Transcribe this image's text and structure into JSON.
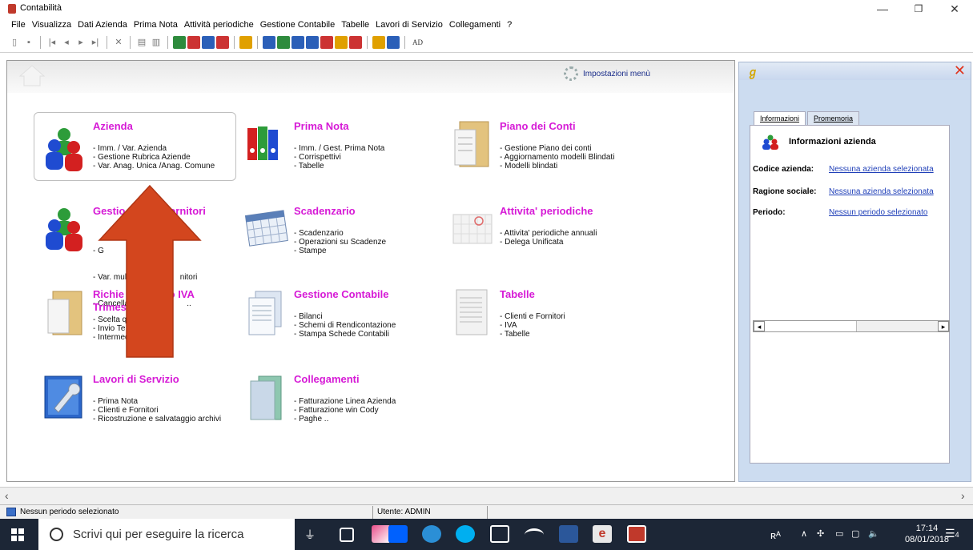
{
  "window": {
    "title": "Contabilità",
    "controls": {
      "minimize": "—",
      "maximize": "❐",
      "close": "✕"
    }
  },
  "menu": [
    "File",
    "Visualizza",
    "Dati Azienda",
    "Prima Nota",
    "Attività periodiche",
    "Gestione Contabile",
    "Tabelle",
    "Lavori di Servizio",
    "Collegamenti",
    "?"
  ],
  "toolbar": {
    "ad_label": "AD"
  },
  "main": {
    "settings_label": "Impostazioni menù",
    "cards": [
      {
        "id": "azienda",
        "title": "Azienda",
        "lines": [
          "- Imm. / Var.  Azienda",
          "- Gestione Rubrica Aziende",
          "- Var. Anag. Unica /Anag. Comune"
        ]
      },
      {
        "id": "prima-nota",
        "title": "Prima Nota",
        "lines": [
          "- Imm. / Gest. Prima Nota",
          "- Corrispettivi",
          "- Tabelle"
        ]
      },
      {
        "id": "piano-conti",
        "title": "Piano dei Conti",
        "lines": [
          "- Gestione Piano dei conti",
          "- Aggiornamento modelli Blindati",
          "- Modelli blindati"
        ]
      },
      {
        "id": "clienti-fornitori",
        "title": "Gestio          e Fornitori",
        "lines": [
          "- G",
          "- Var. mul                        nitori",
          "- Cancella                          .."
        ]
      },
      {
        "id": "scadenzario",
        "title": "Scadenzario",
        "lines": [
          "- Scadenzario",
          "- Operazioni su Scadenze",
          "- Stampe"
        ]
      },
      {
        "id": "attivita-periodiche",
        "title": "Attivita' periodiche",
        "lines": [
          "- Attivita' periodiche annuali",
          "- Delega Unificata"
        ]
      },
      {
        "id": "rimborso-iva",
        "title": "Richie            rso IVA",
        "title2": "Trimes",
        "lines": [
          "- Scelta q",
          "- Invio Te",
          "- Intermediari"
        ]
      },
      {
        "id": "gestione-contabile",
        "title": "Gestione Contabile",
        "lines": [
          "- Bilanci",
          "- Schemi di Rendicontazione",
          "- Stampa Schede Contabili"
        ]
      },
      {
        "id": "tabelle",
        "title": "Tabelle",
        "lines": [
          "- Clienti e Fornitori",
          "- IVA",
          "- Tabelle"
        ]
      },
      {
        "id": "lavori-servizio",
        "title": "Lavori di Servizio",
        "lines": [
          "- Prima Nota",
          "- Clienti e Fornitori",
          "- Ricostruzione e salvataggio archivi"
        ]
      },
      {
        "id": "collegamenti",
        "title": "Collegamenti",
        "lines": [
          "- Fatturazione Linea Azienda",
          "- Fatturazione win Cody",
          "- Paghe .."
        ]
      }
    ]
  },
  "info_panel": {
    "tabs": [
      "Informazioni",
      "Promemoria"
    ],
    "title": "Informazioni azienda",
    "rows": [
      {
        "label": "Codice azienda:",
        "value": "Nessuna azienda selezionata"
      },
      {
        "label": "Ragione sociale:",
        "value": "Nessuna azienda selezionata"
      },
      {
        "label": "Periodo:",
        "value": "Nessun periodo selezionato"
      }
    ],
    "scroll_left": "◂",
    "scroll_right": "▸"
  },
  "main_scroll": {
    "left": "‹",
    "right": "›"
  },
  "status": {
    "period": "Nessun periodo selezionato",
    "user": "Utente: ADMIN"
  },
  "taskbar": {
    "search_placeholder": "Scrivi qui per eseguire la ricerca",
    "tray_text": "ʀᴬ",
    "time": "17:14",
    "date": "08/01/2018",
    "notifications": "4"
  }
}
